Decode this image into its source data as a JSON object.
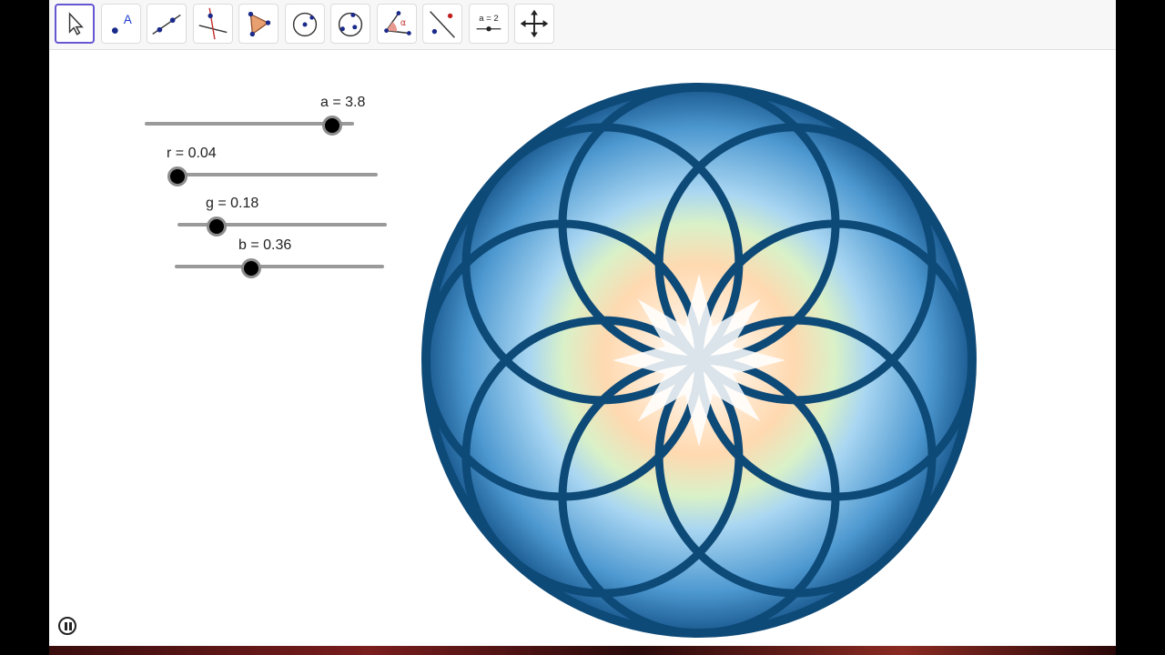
{
  "toolbar": {
    "tools": [
      {
        "name": "move-tool"
      },
      {
        "name": "point-tool",
        "glyph": "A"
      },
      {
        "name": "line-tool"
      },
      {
        "name": "perpendicular-line-tool"
      },
      {
        "name": "polygon-tool"
      },
      {
        "name": "circle-center-point-tool"
      },
      {
        "name": "circle-through-points-tool"
      },
      {
        "name": "angle-tool",
        "glyph": "α"
      },
      {
        "name": "reflect-tool"
      },
      {
        "name": "slider-tool",
        "glyph": "a = 2"
      },
      {
        "name": "move-graphics-view-tool"
      }
    ]
  },
  "sliders": [
    {
      "id": "a",
      "label": "a = 3.8",
      "value": 3.8
    },
    {
      "id": "r",
      "label": "r = 0.04",
      "value": 0.04
    },
    {
      "id": "g",
      "label": "g = 0.18",
      "value": 0.18
    },
    {
      "id": "b",
      "label": "b = 0.36",
      "value": 0.36
    }
  ],
  "colors": {
    "accent": "#6557d2",
    "petal_outline": "#0e4a78",
    "petal_fill": "#5aa6dc",
    "petal_glow": "#ffd2a6"
  }
}
